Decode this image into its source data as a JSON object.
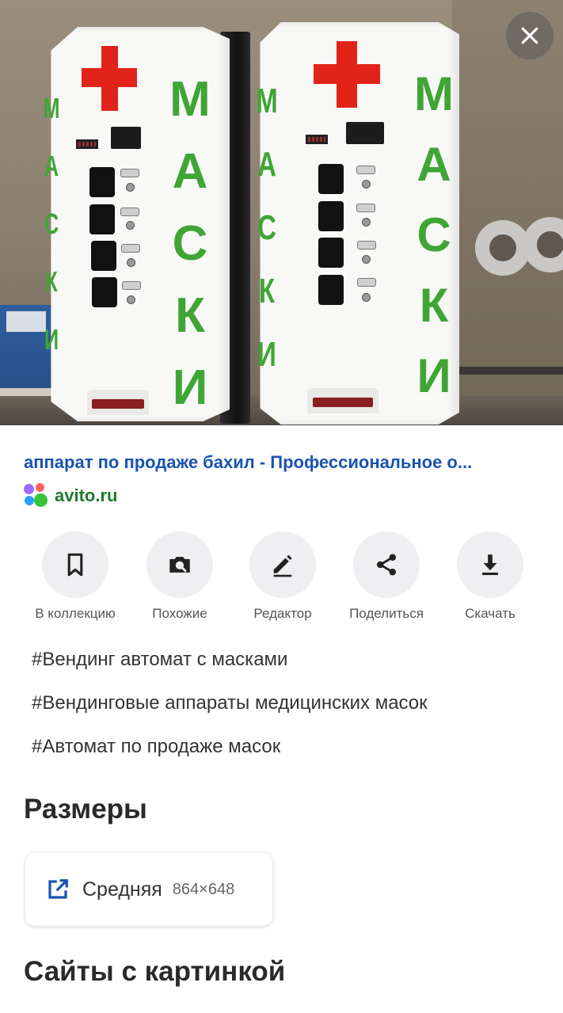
{
  "viewer": {
    "close_icon": "close-icon",
    "photo": {
      "letters": [
        "М",
        "А",
        "С",
        "К",
        "И"
      ]
    }
  },
  "result": {
    "title": "аппарат по продаже бахил - Профессиональное о...",
    "source": "avito.ru",
    "title_color": "#1a53b0",
    "source_color": "#1e7a2d"
  },
  "actions": [
    {
      "label": "В коллекцию",
      "icon": "bookmark-icon"
    },
    {
      "label": "Похожие",
      "icon": "camera-search-icon"
    },
    {
      "label": "Редактор",
      "icon": "pencil-icon"
    },
    {
      "label": "Поделиться",
      "icon": "share-icon"
    },
    {
      "label": "Скачать",
      "icon": "download-icon"
    }
  ],
  "tags": [
    "#Вендинг автомат с масками",
    "#Вендинговые аппараты медицинских масок",
    "#Автомат по продаже масок"
  ],
  "sizes": {
    "title": "Размеры",
    "items": [
      {
        "label": "Средняя",
        "dims": "864×648",
        "icon": "open-external-icon"
      }
    ]
  },
  "sites": {
    "title": "Сайты с картинкой"
  }
}
